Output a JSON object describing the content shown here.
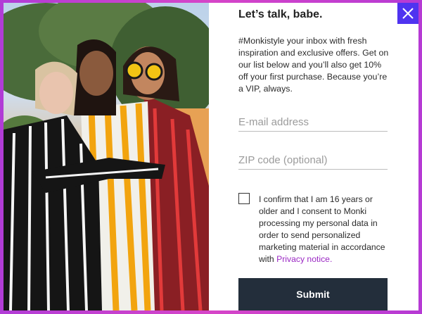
{
  "modal": {
    "title": "Let’s talk, babe.",
    "intro": "#Monkistyle your inbox with fresh inspiration and exclusive offers. Get on our list below and you’ll also get 10% off your first purchase. Because you’re a VIP, always.",
    "email": {
      "value": "",
      "placeholder": "E-mail address"
    },
    "zip": {
      "value": "",
      "placeholder": "ZIP code (optional)"
    },
    "consent": {
      "checked": false,
      "text": "I confirm that I am 16 years or older and I consent to Monki processing my personal data in order to send personalized marketing material in accordance with",
      "link_label": "Privacy notice."
    },
    "submit_label": "Submit",
    "close_icon": "close-icon"
  },
  "colors": {
    "border_gradient": "#c741d0",
    "close_button": "#4f33f0",
    "submit_button": "#232e3b",
    "link": "#9b28c4"
  }
}
